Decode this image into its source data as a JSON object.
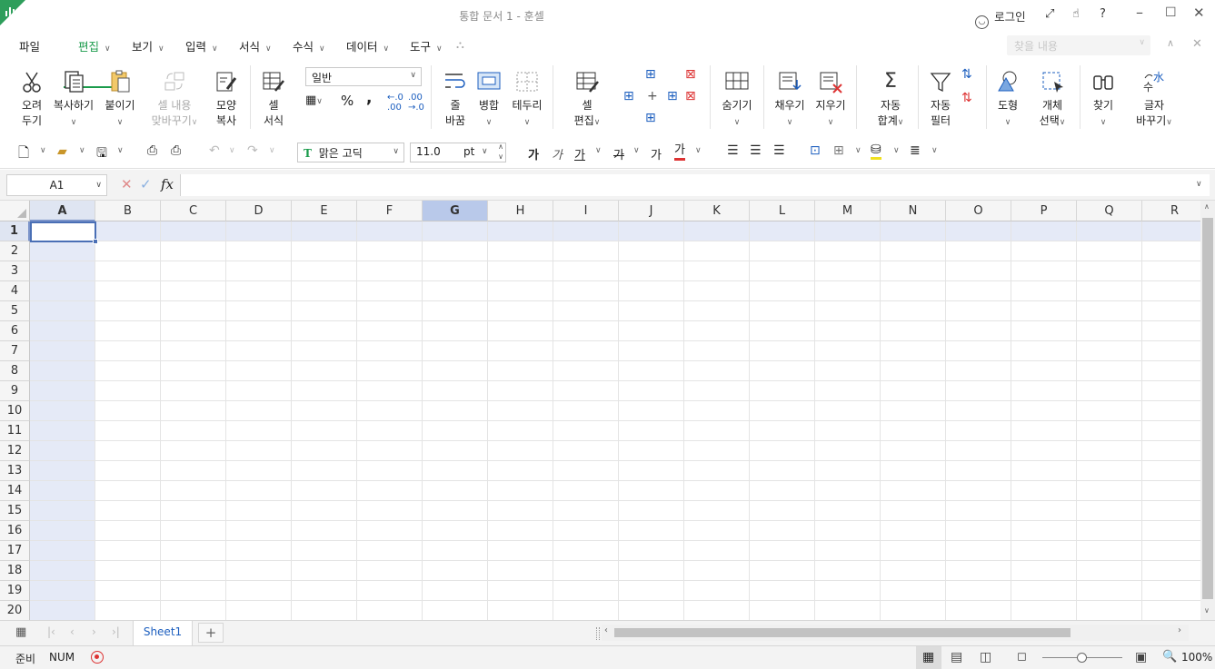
{
  "window": {
    "title": "통합 문서 1 - 훈셀",
    "login_label": "로그인"
  },
  "menubar": {
    "file": "파일",
    "tabs": [
      "편집",
      "보기",
      "입력",
      "서식",
      "수식",
      "데이터",
      "도구"
    ],
    "active_tab": "편집",
    "search_placeholder": "찾을 내용"
  },
  "ribbon": {
    "cut": [
      "오려",
      "두기"
    ],
    "copy": "복사하기",
    "paste": "붙이기",
    "paste_fit": [
      "셀 내용",
      "맞바꾸기"
    ],
    "format_painter": [
      "모양",
      "복사"
    ],
    "cell_format": [
      "셀",
      "서식"
    ],
    "number_format": "일반",
    "percent": "%",
    "comma": ",",
    "wrap": [
      "줄",
      "바꿈"
    ],
    "merge": "병합",
    "border": "테두리",
    "cell_edit": [
      "셀",
      "편집"
    ],
    "hide": "숨기기",
    "fill": "채우기",
    "clear": "지우기",
    "autosum": [
      "자동",
      "합계"
    ],
    "autofilter": [
      "자동",
      "필터"
    ],
    "shape": "도형",
    "select_object": [
      "개체",
      "선택"
    ],
    "find": "찾기",
    "replace": [
      "글자",
      "바꾸기"
    ]
  },
  "quickbar": {
    "font_name": "맑은 고딕",
    "font_size": "11.0",
    "font_unit": "pt",
    "bold": "가",
    "italic": "가",
    "underline": "가",
    "strike": "가",
    "plain": "가",
    "font_color_glyph": "가"
  },
  "formula_bar": {
    "name_box": "A1",
    "fx": "fx",
    "value": ""
  },
  "grid": {
    "columns": [
      "A",
      "B",
      "C",
      "D",
      "E",
      "F",
      "G",
      "H",
      "I",
      "J",
      "K",
      "L",
      "M",
      "N",
      "O",
      "P",
      "Q",
      "R"
    ],
    "rows": [
      "1",
      "2",
      "3",
      "4",
      "5",
      "6",
      "7",
      "8",
      "9",
      "10",
      "11",
      "12",
      "13",
      "14",
      "15",
      "16",
      "17",
      "18",
      "19",
      "20"
    ],
    "selected_cell": "A1",
    "highlight_column": "G"
  },
  "sheets": {
    "tabs": [
      "Sheet1"
    ],
    "add": "+"
  },
  "status": {
    "ready": "준비",
    "num": "NUM",
    "zoom": "100%"
  },
  "colors": {
    "accent": "#1a9b4b",
    "selection": "#e5eaf7",
    "header_selected": "#b9c9ea"
  }
}
